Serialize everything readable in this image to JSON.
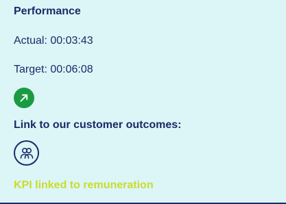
{
  "performance": {
    "title": "Performance",
    "actual": "Actual: 00:03:43",
    "target": "Target: 00:06:08",
    "trend_icon": "arrow-up-right-icon",
    "trend_color": "#1a9b42"
  },
  "outcomes": {
    "label": "Link to our customer outcomes:",
    "icon": "customers-icon"
  },
  "kpi": {
    "label": "KPI linked to remuneration",
    "color": "#c9dc2c"
  },
  "theme": {
    "background": "#dcf5f7",
    "text": "#1a2a66"
  }
}
